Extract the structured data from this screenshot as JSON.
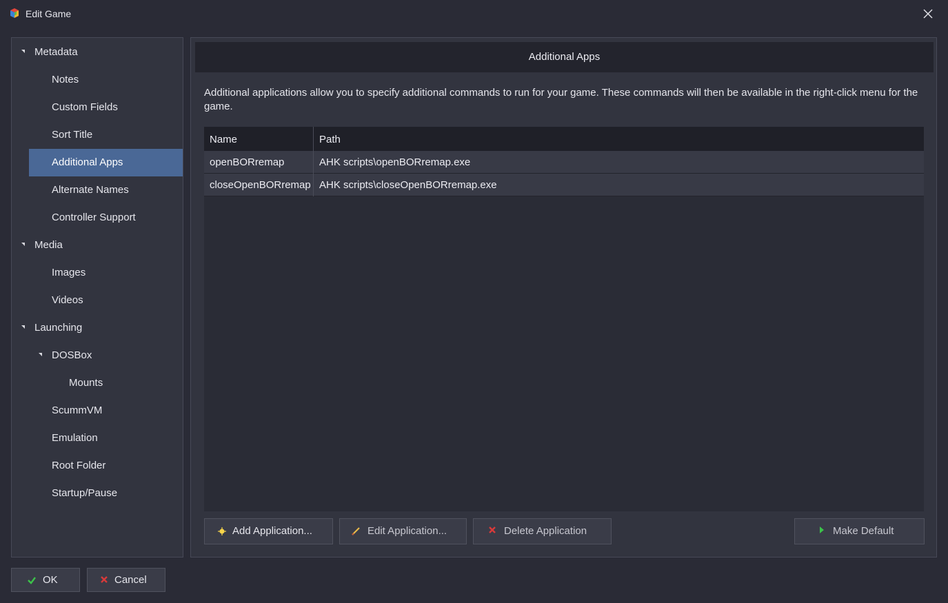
{
  "window": {
    "title": "Edit Game"
  },
  "sidebar": {
    "items": [
      {
        "label": "Metadata"
      },
      {
        "label": "Notes"
      },
      {
        "label": "Custom Fields"
      },
      {
        "label": "Sort Title"
      },
      {
        "label": "Additional Apps"
      },
      {
        "label": "Alternate Names"
      },
      {
        "label": "Controller Support"
      },
      {
        "label": "Media"
      },
      {
        "label": "Images"
      },
      {
        "label": "Videos"
      },
      {
        "label": "Launching"
      },
      {
        "label": "DOSBox"
      },
      {
        "label": "Mounts"
      },
      {
        "label": "ScummVM"
      },
      {
        "label": "Emulation"
      },
      {
        "label": "Root Folder"
      },
      {
        "label": "Startup/Pause"
      }
    ],
    "selected": "Additional Apps"
  },
  "main": {
    "header": "Additional Apps",
    "description": "Additional applications allow you to specify additional commands to run for your game.  These commands will then be available in the right-click menu for the game.",
    "table": {
      "columns": [
        "Name",
        "Path"
      ],
      "rows": [
        {
          "name": "openBORremap",
          "path": "AHK scripts\\openBORremap.exe"
        },
        {
          "name": "closeOpenBORremap",
          "path": "AHK scripts\\closeOpenBORremap.exe"
        }
      ]
    },
    "buttons": {
      "add": "Add Application...",
      "edit": "Edit Application...",
      "delete": "Delete Application",
      "make_default": "Make Default"
    }
  },
  "footer": {
    "ok": "OK",
    "cancel": "Cancel"
  },
  "colors": {
    "background": "#2a2b36",
    "panel": "#32343f",
    "selected": "#4a6896",
    "header": "#23242d"
  },
  "icons": {
    "app": "launchbox-cube-icon",
    "close": "close-icon",
    "add": "add-star-icon",
    "edit": "pencil-icon",
    "delete": "red-x-icon",
    "make_default": "green-arrow-icon",
    "ok": "check-icon",
    "cancel": "red-x-icon",
    "expand": "expanded-triangle-icon"
  }
}
